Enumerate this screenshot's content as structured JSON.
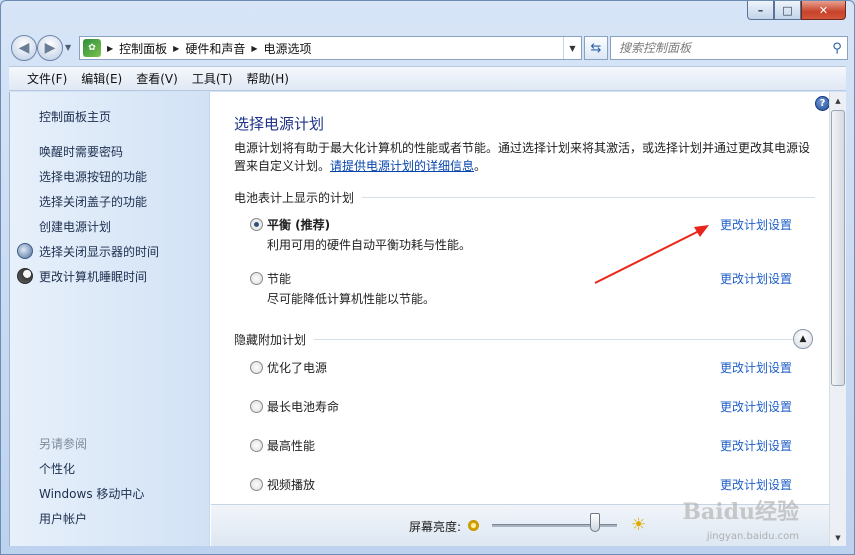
{
  "window": {
    "minimize_icon": "minimize-icon",
    "maximize_icon": "maximize-icon",
    "close_icon": "close-icon"
  },
  "address": {
    "crumbs": [
      "控制面板",
      "硬件和声音",
      "电源选项"
    ]
  },
  "search": {
    "placeholder": "搜索控制面板"
  },
  "menu": {
    "items": [
      "文件(F)",
      "编辑(E)",
      "查看(V)",
      "工具(T)",
      "帮助(H)"
    ]
  },
  "sidebar": {
    "home": "控制面板主页",
    "links": [
      "唤醒时需要密码",
      "选择电源按钮的功能",
      "选择关闭盖子的功能",
      "创建电源计划",
      "选择关闭显示器的时间",
      "更改计算机睡眠时间"
    ],
    "see_also_heading": "另请参阅",
    "see_also": [
      "个性化",
      "Windows 移动中心",
      "用户帐户"
    ]
  },
  "main": {
    "title": "选择电源计划",
    "description": "电源计划将有助于最大化计算机的性能或者节能。通过选择计划来将其激活，或选择计划并通过更改其电源设置来自定义计划。",
    "details_link": "请提供电源计划的详细信息",
    "section_battery": "电池表计上显示的计划",
    "section_hidden": "隐藏附加计划",
    "change_link": "更改计划设置",
    "plans": [
      {
        "name": "平衡 (推荐)",
        "desc": "利用可用的硬件自动平衡功耗与性能。",
        "selected": true
      },
      {
        "name": "节能",
        "desc": "尽可能降低计算机性能以节能。",
        "selected": false
      }
    ],
    "hidden_plans": [
      "优化了电源",
      "最长电池寿命",
      "最高性能",
      "视频播放"
    ]
  },
  "footer": {
    "brightness_label": "屏幕亮度:",
    "brightness_level": 0.82
  },
  "watermark": {
    "text": "Baidu经验",
    "url": "jingyan.baidu.com"
  },
  "colors": {
    "link": "#1f5fc8",
    "title": "#1e3287",
    "annotation_arrow": "#e8261c"
  }
}
